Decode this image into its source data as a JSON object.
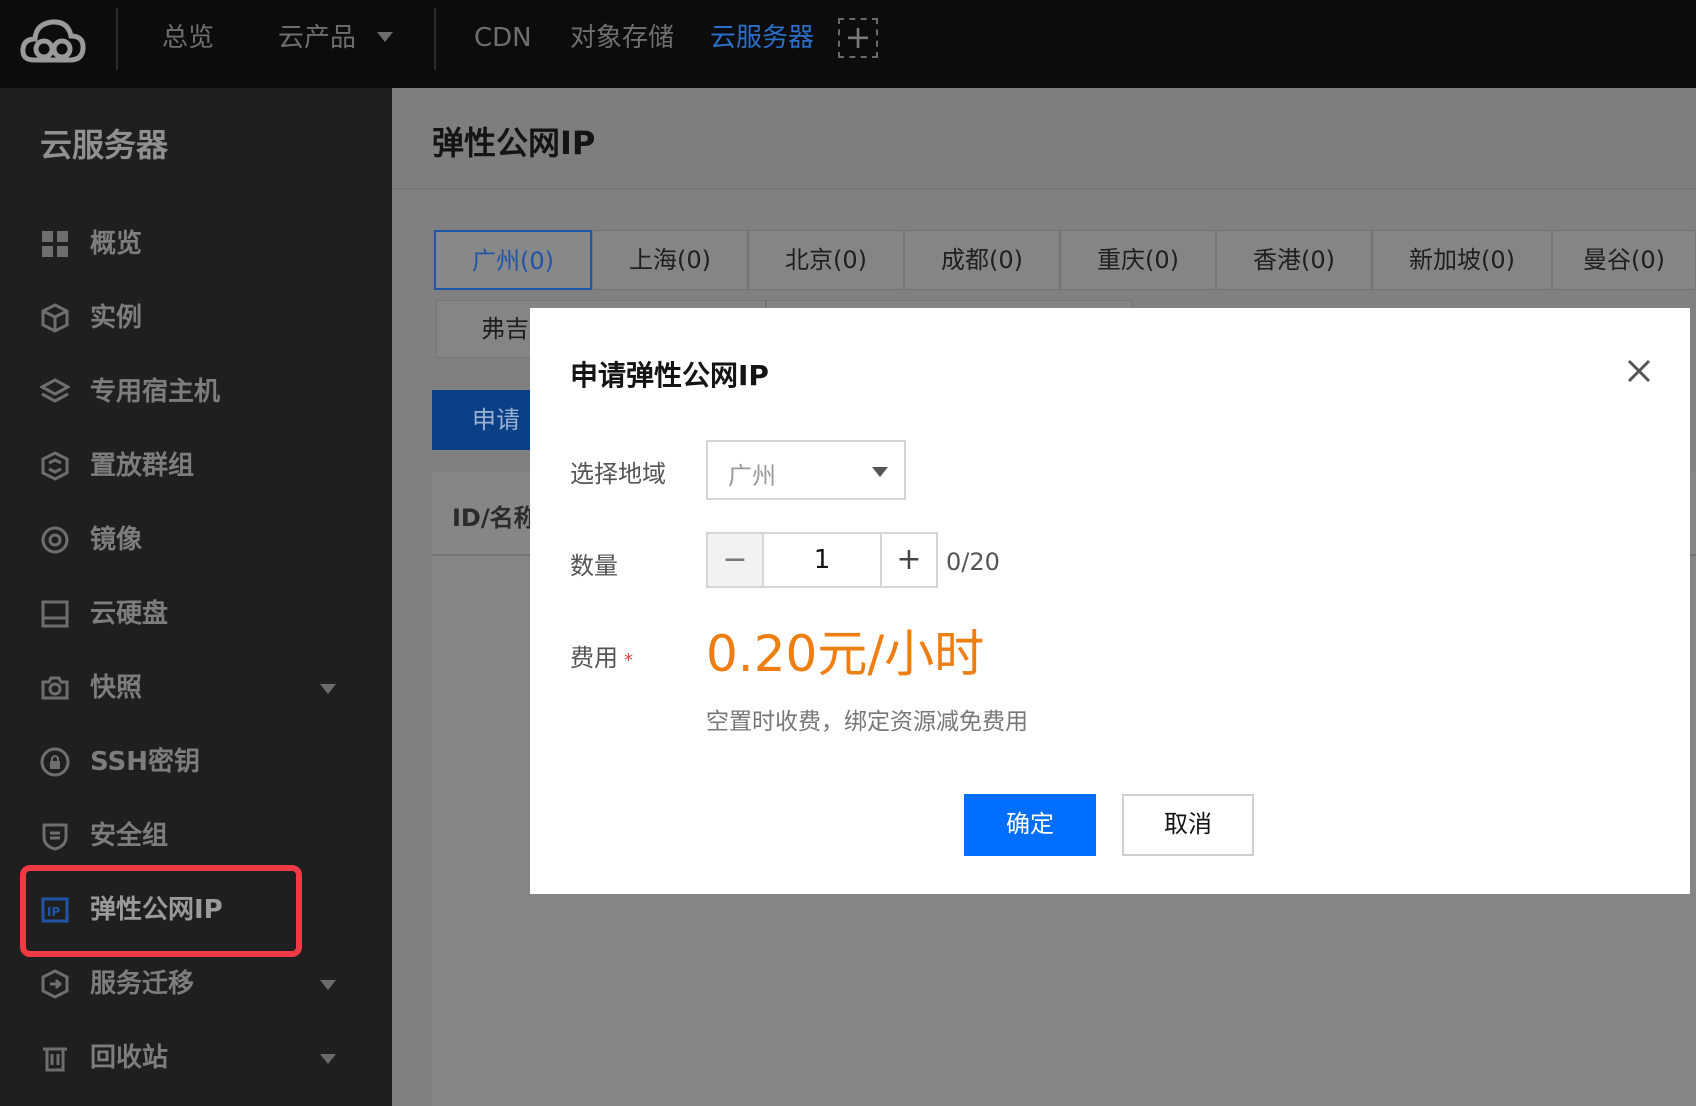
{
  "topbar": {
    "nav": [
      "总览",
      "云产品",
      "CDN",
      "对象存储",
      "云服务器"
    ],
    "active": "云服务器",
    "add_tab": "+"
  },
  "sidebar": {
    "title": "云服务器",
    "items": [
      {
        "label": "概览",
        "icon": "grid-icon"
      },
      {
        "label": "实例",
        "icon": "cube-icon"
      },
      {
        "label": "专用宿主机",
        "icon": "layers-icon"
      },
      {
        "label": "置放群组",
        "icon": "hexagon-stack-icon"
      },
      {
        "label": "镜像",
        "icon": "disc-icon"
      },
      {
        "label": "云硬盘",
        "icon": "disk-icon"
      },
      {
        "label": "快照",
        "icon": "camera-icon",
        "expandable": true
      },
      {
        "label": "SSH密钥",
        "icon": "lock-icon"
      },
      {
        "label": "安全组",
        "icon": "shield-icon"
      },
      {
        "label": "弹性公网IP",
        "icon": "ip-icon",
        "active": true
      },
      {
        "label": "服务迁移",
        "icon": "migrate-icon",
        "expandable": true
      },
      {
        "label": "回收站",
        "icon": "trash-icon",
        "expandable": true
      }
    ]
  },
  "main": {
    "title": "弹性公网IP",
    "region_tabs": [
      "广州(0)",
      "上海(0)",
      "北京(0)",
      "成都(0)",
      "重庆(0)",
      "香港(0)",
      "新加坡(0)",
      "曼谷(0)"
    ],
    "region_tab_row2": "弗吉",
    "apply_button": "申请",
    "table_header": "ID/名称"
  },
  "modal": {
    "title": "申请弹性公网IP",
    "region_label": "选择地域",
    "region_value": "广州",
    "quantity_label": "数量",
    "quantity_minus": "−",
    "quantity_value": "1",
    "quantity_plus": "+",
    "quantity_limit": "0/20",
    "fee_label": "费用",
    "fee_required_mark": "*",
    "fee_value": "0.20元/小时",
    "fee_note": "空置时收费，绑定资源减免费用",
    "ok_label": "确定",
    "cancel_label": "取消"
  },
  "colors": {
    "accent": "#006eff",
    "price": "#ee7d12",
    "highlight": "#ee3a45"
  }
}
